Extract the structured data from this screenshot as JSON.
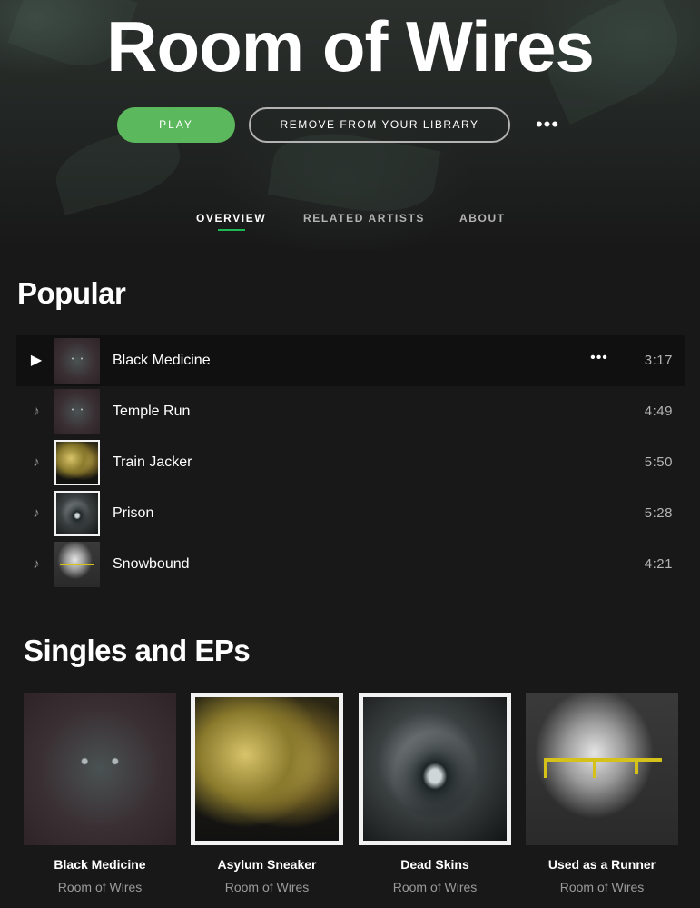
{
  "artist": {
    "name": "Room of Wires"
  },
  "actions": {
    "play_label": "PLAY",
    "remove_label": "REMOVE FROM YOUR LIBRARY",
    "more_label": "•••"
  },
  "tabs": [
    {
      "label": "OVERVIEW",
      "active": true
    },
    {
      "label": "RELATED ARTISTS",
      "active": false
    },
    {
      "label": "ABOUT",
      "active": false
    }
  ],
  "popular": {
    "heading": "Popular",
    "tracks": [
      {
        "title": "Black Medicine",
        "duration": "3:17",
        "icon": "play-icon",
        "more": "•••"
      },
      {
        "title": "Temple Run",
        "duration": "4:49",
        "icon": "music-note-icon"
      },
      {
        "title": "Train Jacker",
        "duration": "5:50",
        "icon": "music-note-icon"
      },
      {
        "title": "Prison",
        "duration": "5:28",
        "icon": "music-note-icon"
      },
      {
        "title": "Snowbound",
        "duration": "4:21",
        "icon": "music-note-icon"
      }
    ]
  },
  "singles": {
    "heading": "Singles and EPs",
    "items": [
      {
        "title": "Black Medicine",
        "artist": "Room of Wires"
      },
      {
        "title": "Asylum Sneaker",
        "artist": "Room of Wires"
      },
      {
        "title": "Dead Skins",
        "artist": "Room of Wires"
      },
      {
        "title": "Used as a Runner",
        "artist": "Room of Wires"
      }
    ]
  },
  "colors": {
    "accent_green": "#1db954",
    "play_button": "#5cb85c",
    "background": "#181818",
    "row_highlight": "#101010"
  }
}
